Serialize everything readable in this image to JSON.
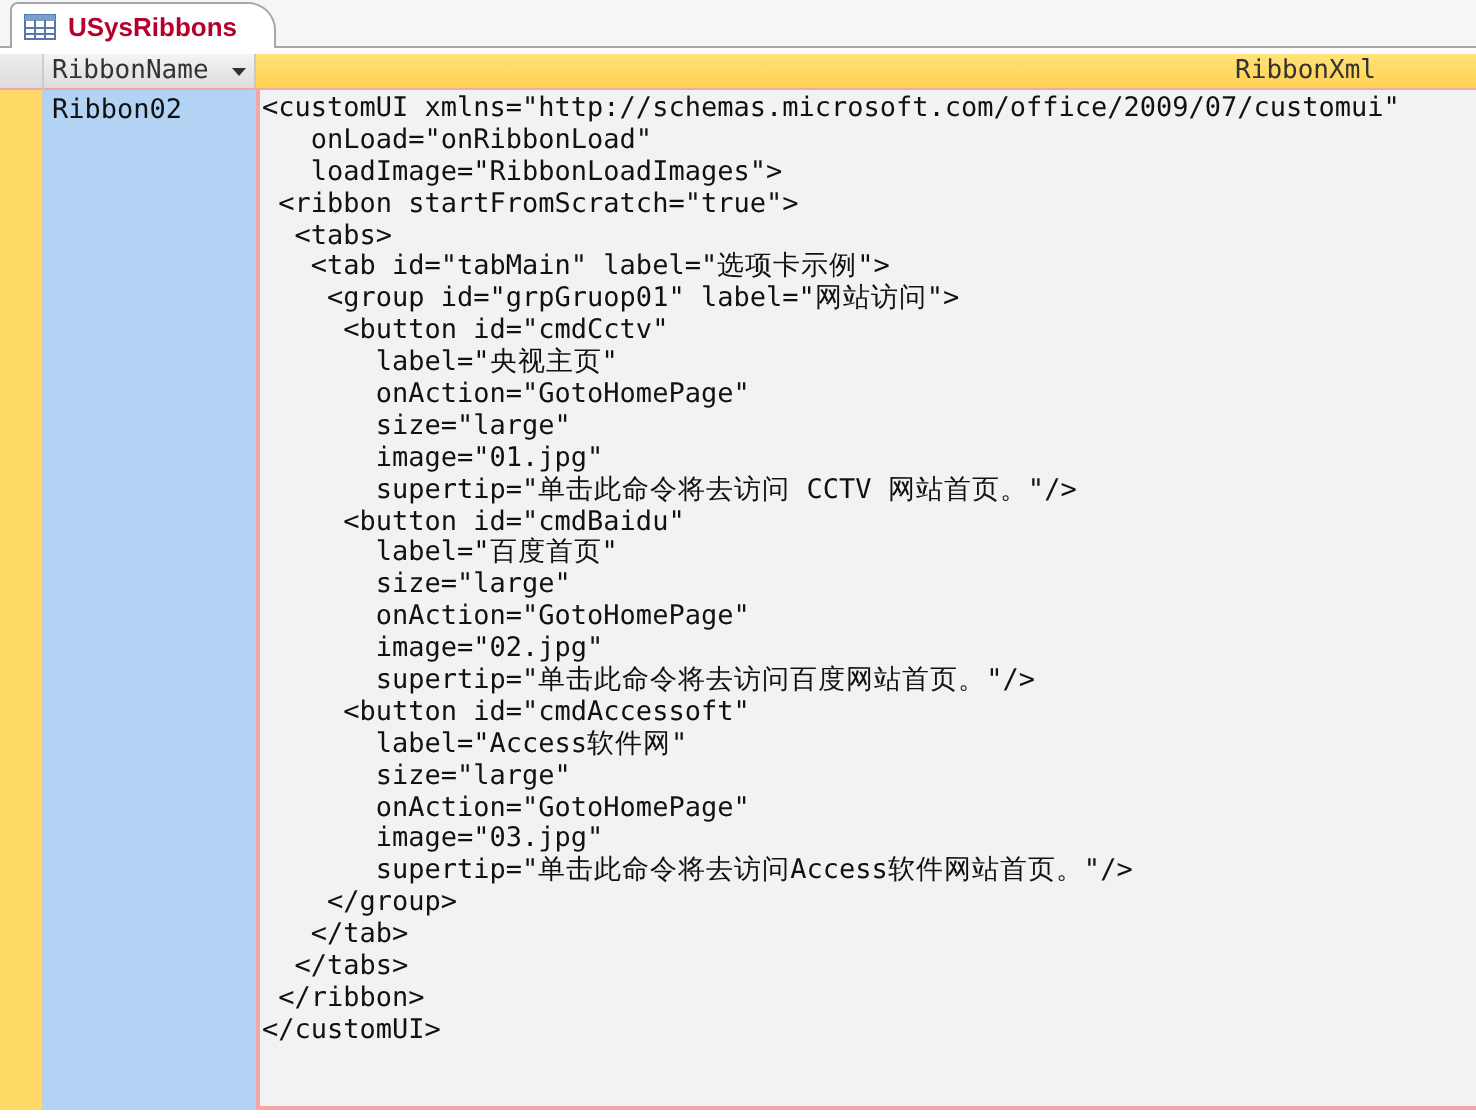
{
  "document_tab": {
    "title": "USysRibbons"
  },
  "columns": [
    {
      "label": "RibbonName",
      "kind": "text",
      "filter_menu": true
    },
    {
      "label": "RibbonXml",
      "kind": "memo",
      "filter_menu": false
    }
  ],
  "rows": [
    {
      "selected": true,
      "ribbon_name": "Ribbon02",
      "ribbon_xml": [
        "<customUI xmlns=\"http://schemas.microsoft.com/office/2009/07/customui\"",
        "   onLoad=\"onRibbonLoad\"",
        "   loadImage=\"RibbonLoadImages\">",
        " <ribbon startFromScratch=\"true\">",
        "  <tabs>",
        "   <tab id=\"tabMain\" label=\"选项卡示例\">",
        "    <group id=\"grpGruop01\" label=\"网站访问\">",
        "     <button id=\"cmdCctv\"",
        "       label=\"央视主页\"",
        "       onAction=\"GotoHomePage\"",
        "       size=\"large\"",
        "       image=\"01.jpg\"",
        "       supertip=\"单击此命令将去访问 CCTV 网站首页。\"/>",
        "     <button id=\"cmdBaidu\"",
        "       label=\"百度首页\"",
        "       size=\"large\"",
        "       onAction=\"GotoHomePage\"",
        "       image=\"02.jpg\"",
        "       supertip=\"单击此命令将去访问百度网站首页。\"/>",
        "     <button id=\"cmdAccessoft\"",
        "       label=\"Access软件网\"",
        "       size=\"large\"",
        "       onAction=\"GotoHomePage\"",
        "       image=\"03.jpg\"",
        "       supertip=\"单击此命令将去访问Access软件网站首页。\"/>",
        "    </group>",
        "   </tab>",
        "  </tabs>",
        " </ribbon>",
        "</customUI>"
      ]
    }
  ]
}
